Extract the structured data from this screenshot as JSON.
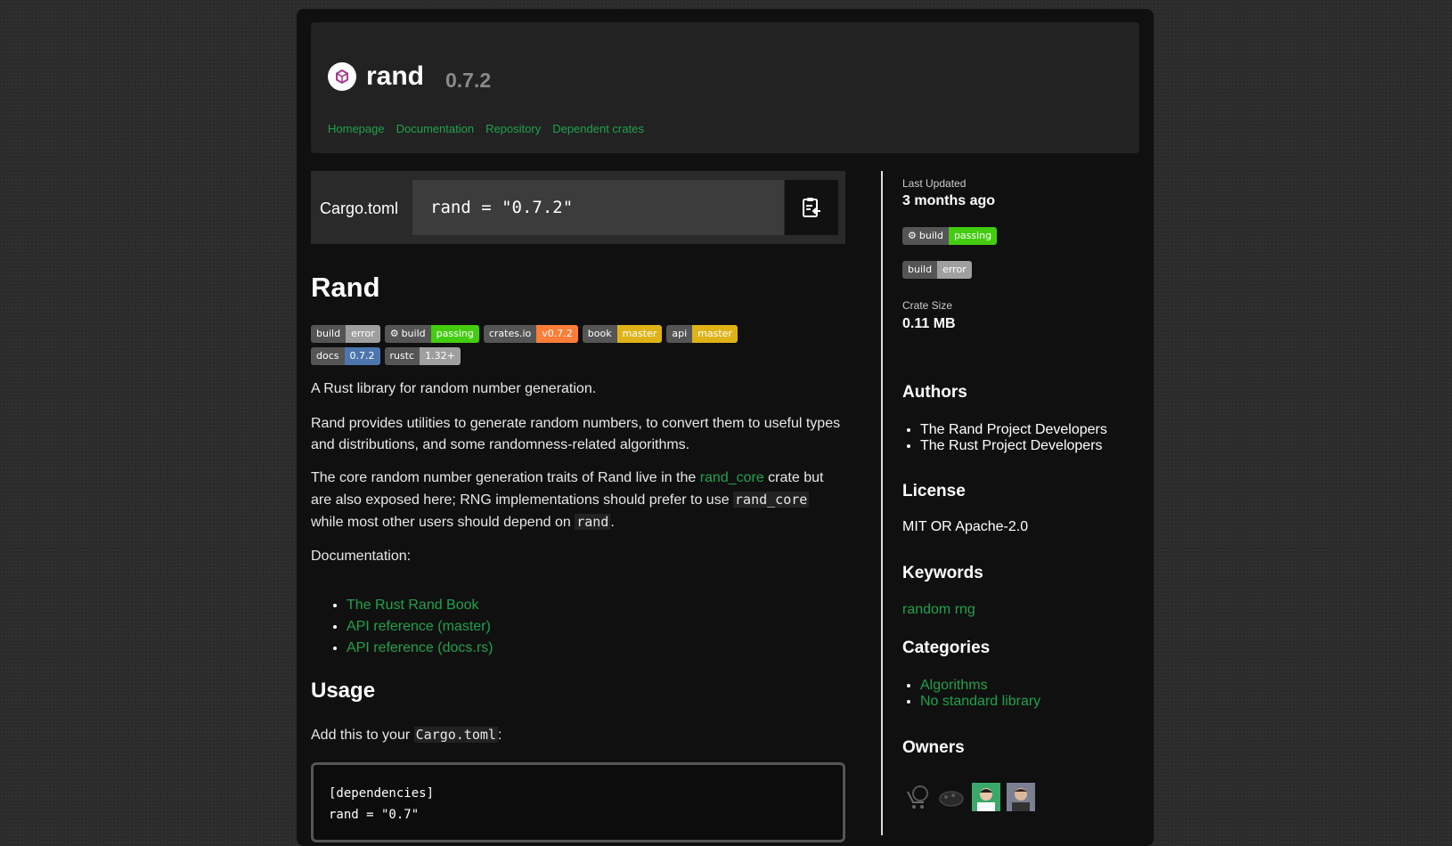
{
  "header": {
    "crate_name": "rand",
    "version": "0.7.2",
    "nav": [
      "Homepage",
      "Documentation",
      "Repository",
      "Dependent crates"
    ]
  },
  "install": {
    "label": "Cargo.toml",
    "snippet": "rand = \"0.7.2\"",
    "copy_icon": "clipboard-copy-icon"
  },
  "readme": {
    "title": "Rand",
    "badges": [
      {
        "left": "build",
        "right": "error",
        "color": "#9f9f9f",
        "icon": false
      },
      {
        "left": "build",
        "right": "passing",
        "color": "#4c1",
        "icon": true
      },
      {
        "left": "crates.io",
        "right": "v0.7.2",
        "color": "#fe7d37",
        "icon": false
      },
      {
        "left": "book",
        "right": "master",
        "color": "#dfb317",
        "icon": false
      },
      {
        "left": "api",
        "right": "master",
        "color": "#dfb317",
        "icon": false
      },
      {
        "left": "docs",
        "right": "0.7.2",
        "color": "#4d76ae",
        "icon": false
      },
      {
        "left": "rustc",
        "right": "1.32+",
        "color": "#9f9f9f",
        "icon": false
      }
    ],
    "p1": "A Rust library for random number generation.",
    "p2": "Rand provides utilities to generate random numbers, to convert them to useful types and distributions, and some randomness-related algorithms.",
    "p3_a": "The core random number generation traits of Rand live in the ",
    "p3_link": "rand_core",
    "p3_b": " crate but are also exposed here; RNG implementations should prefer to use ",
    "p3_code1": "rand_core",
    "p3_c": " while most other users should depend on ",
    "p3_code2": "rand",
    "p3_d": ".",
    "docs_label": "Documentation:",
    "doc_links": [
      "The Rust Rand Book",
      "API reference (master)",
      "API reference (docs.rs)"
    ],
    "usage_title": "Usage",
    "usage_a": "Add this to your ",
    "usage_code": "Cargo.toml",
    "usage_b": ":",
    "code_line1": "[dependencies]",
    "code_line2": "rand = \"0.7\""
  },
  "sidebar": {
    "last_updated_label": "Last Updated",
    "last_updated_value": "3 months ago",
    "badge1": {
      "left": "build",
      "right": "passing",
      "color": "#4c1"
    },
    "badge2": {
      "left": "build",
      "right": "error",
      "color": "#9f9f9f"
    },
    "size_label": "Crate Size",
    "size_value": "0.11 MB",
    "authors_title": "Authors",
    "authors": [
      "The Rand Project Developers",
      "The Rust Project Developers"
    ],
    "license_title": "License",
    "license": "MIT OR Apache-2.0",
    "keywords_title": "Keywords",
    "keywords": [
      "random",
      "rng"
    ],
    "categories_title": "Categories",
    "categories": [
      "Algorithms",
      "No standard library"
    ],
    "owners_title": "Owners",
    "owners": [
      "owner-avatar-1",
      "owner-avatar-2",
      "owner-avatar-3",
      "owner-avatar-4"
    ]
  }
}
